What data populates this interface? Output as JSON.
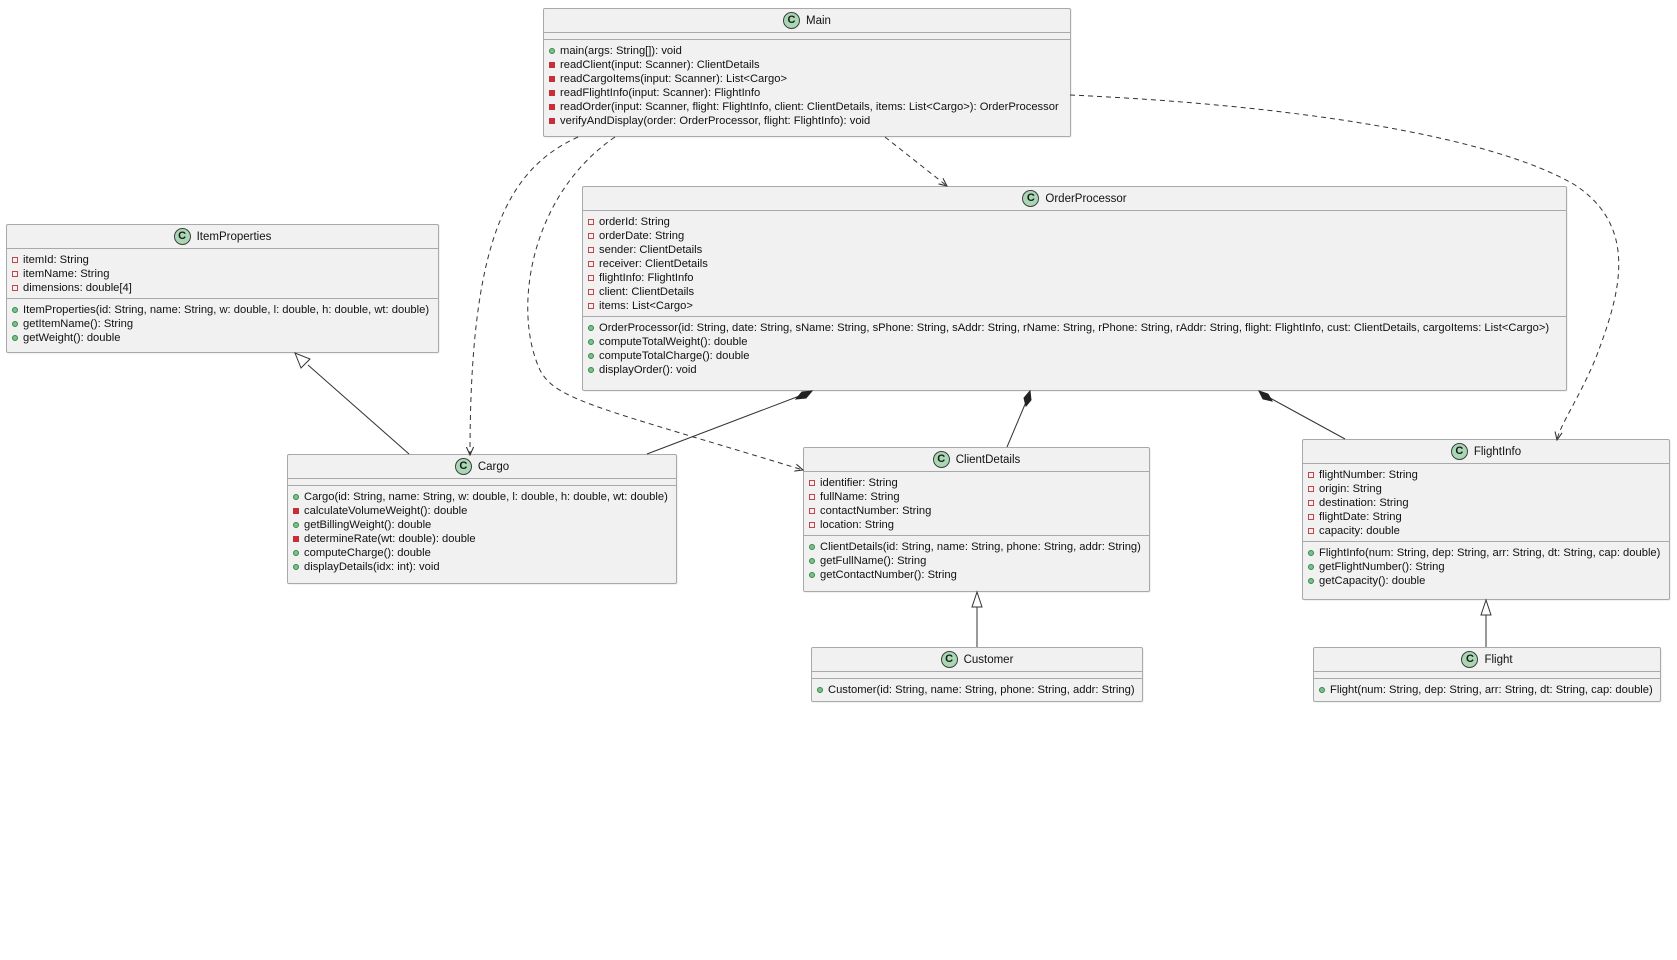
{
  "diagram": {
    "badge_letter": "C",
    "colors": {
      "class_fill": "#f1f1f1",
      "class_border": "#a9a9a9",
      "badge_fill": "#a9d7b4",
      "public_marker": "#7fbf8e",
      "private_marker": "#c72f38",
      "edge_color": "#333333"
    },
    "classes": {
      "main": {
        "name": "Main",
        "fields": [],
        "methods": [
          {
            "vis": "public",
            "text": "main(args: String[]): void"
          },
          {
            "vis": "private",
            "text": "readClient(input: Scanner): ClientDetails"
          },
          {
            "vis": "private",
            "text": "readCargoItems(input: Scanner): List<Cargo>"
          },
          {
            "vis": "private",
            "text": "readFlightInfo(input: Scanner): FlightInfo"
          },
          {
            "vis": "private",
            "text": "readOrder(input: Scanner, flight: FlightInfo, client: ClientDetails, items: List<Cargo>): OrderProcessor"
          },
          {
            "vis": "private",
            "text": "verifyAndDisplay(order: OrderProcessor, flight: FlightInfo): void"
          }
        ]
      },
      "orderprocessor": {
        "name": "OrderProcessor",
        "fields": [
          {
            "vis": "private",
            "text": "orderId: String"
          },
          {
            "vis": "private",
            "text": "orderDate: String"
          },
          {
            "vis": "private",
            "text": "sender: ClientDetails"
          },
          {
            "vis": "private",
            "text": "receiver: ClientDetails"
          },
          {
            "vis": "private",
            "text": "flightInfo: FlightInfo"
          },
          {
            "vis": "private",
            "text": "client: ClientDetails"
          },
          {
            "vis": "private",
            "text": "items: List<Cargo>"
          }
        ],
        "methods": [
          {
            "vis": "public",
            "text": "OrderProcessor(id: String, date: String, sName: String, sPhone: String, sAddr: String, rName: String, rPhone: String, rAddr: String, flight: FlightInfo, cust: ClientDetails, cargoItems: List<Cargo>)"
          },
          {
            "vis": "public",
            "text": "computeTotalWeight(): double"
          },
          {
            "vis": "public",
            "text": "computeTotalCharge(): double"
          },
          {
            "vis": "public",
            "text": "displayOrder(): void"
          }
        ]
      },
      "itemproperties": {
        "name": "ItemProperties",
        "fields": [
          {
            "vis": "private",
            "text": "itemId: String"
          },
          {
            "vis": "private",
            "text": "itemName: String"
          },
          {
            "vis": "private",
            "text": "dimensions: double[4]"
          }
        ],
        "methods": [
          {
            "vis": "public",
            "text": "ItemProperties(id: String, name: String, w: double, l: double, h: double, wt: double)"
          },
          {
            "vis": "public",
            "text": "getItemName(): String"
          },
          {
            "vis": "public",
            "text": "getWeight(): double"
          }
        ]
      },
      "cargo": {
        "name": "Cargo",
        "fields": [],
        "methods": [
          {
            "vis": "public",
            "text": "Cargo(id: String, name: String, w: double, l: double, h: double, wt: double)"
          },
          {
            "vis": "private",
            "text": "calculateVolumeWeight(): double"
          },
          {
            "vis": "public",
            "text": "getBillingWeight(): double"
          },
          {
            "vis": "private",
            "text": "determineRate(wt: double): double"
          },
          {
            "vis": "public",
            "text": "computeCharge(): double"
          },
          {
            "vis": "public",
            "text": "displayDetails(idx: int): void"
          }
        ]
      },
      "clientdetails": {
        "name": "ClientDetails",
        "fields": [
          {
            "vis": "private",
            "text": "identifier: String"
          },
          {
            "vis": "private",
            "text": "fullName: String"
          },
          {
            "vis": "private",
            "text": "contactNumber: String"
          },
          {
            "vis": "private",
            "text": "location: String"
          }
        ],
        "methods": [
          {
            "vis": "public",
            "text": "ClientDetails(id: String, name: String, phone: String, addr: String)"
          },
          {
            "vis": "public",
            "text": "getFullName(): String"
          },
          {
            "vis": "public",
            "text": "getContactNumber(): String"
          }
        ]
      },
      "flightinfo": {
        "name": "FlightInfo",
        "fields": [
          {
            "vis": "private",
            "text": "flightNumber: String"
          },
          {
            "vis": "private",
            "text": "origin: String"
          },
          {
            "vis": "private",
            "text": "destination: String"
          },
          {
            "vis": "private",
            "text": "flightDate: String"
          },
          {
            "vis": "private",
            "text": "capacity: double"
          }
        ],
        "methods": [
          {
            "vis": "public",
            "text": "FlightInfo(num: String, dep: String, arr: String, dt: String, cap: double)"
          },
          {
            "vis": "public",
            "text": "getFlightNumber(): String"
          },
          {
            "vis": "public",
            "text": "getCapacity(): double"
          }
        ]
      },
      "customer": {
        "name": "Customer",
        "fields": [],
        "methods": [
          {
            "vis": "public",
            "text": "Customer(id: String, name: String, phone: String, addr: String)"
          }
        ]
      },
      "flight": {
        "name": "Flight",
        "fields": [],
        "methods": [
          {
            "vis": "public",
            "text": "Flight(num: String, dep: String, arr: String, dt: String, cap: double)"
          }
        ]
      }
    },
    "relationships": [
      {
        "from": "Main",
        "to": "OrderProcessor",
        "type": "dependency"
      },
      {
        "from": "Main",
        "to": "Cargo",
        "type": "dependency"
      },
      {
        "from": "Main",
        "to": "ClientDetails",
        "type": "dependency"
      },
      {
        "from": "Main",
        "to": "FlightInfo",
        "type": "dependency"
      },
      {
        "from": "OrderProcessor",
        "to": "Cargo",
        "type": "composition"
      },
      {
        "from": "OrderProcessor",
        "to": "ClientDetails",
        "type": "composition"
      },
      {
        "from": "OrderProcessor",
        "to": "FlightInfo",
        "type": "composition"
      },
      {
        "from": "Cargo",
        "to": "ItemProperties",
        "type": "inheritance"
      },
      {
        "from": "Customer",
        "to": "ClientDetails",
        "type": "inheritance"
      },
      {
        "from": "Flight",
        "to": "FlightInfo",
        "type": "inheritance"
      }
    ]
  }
}
